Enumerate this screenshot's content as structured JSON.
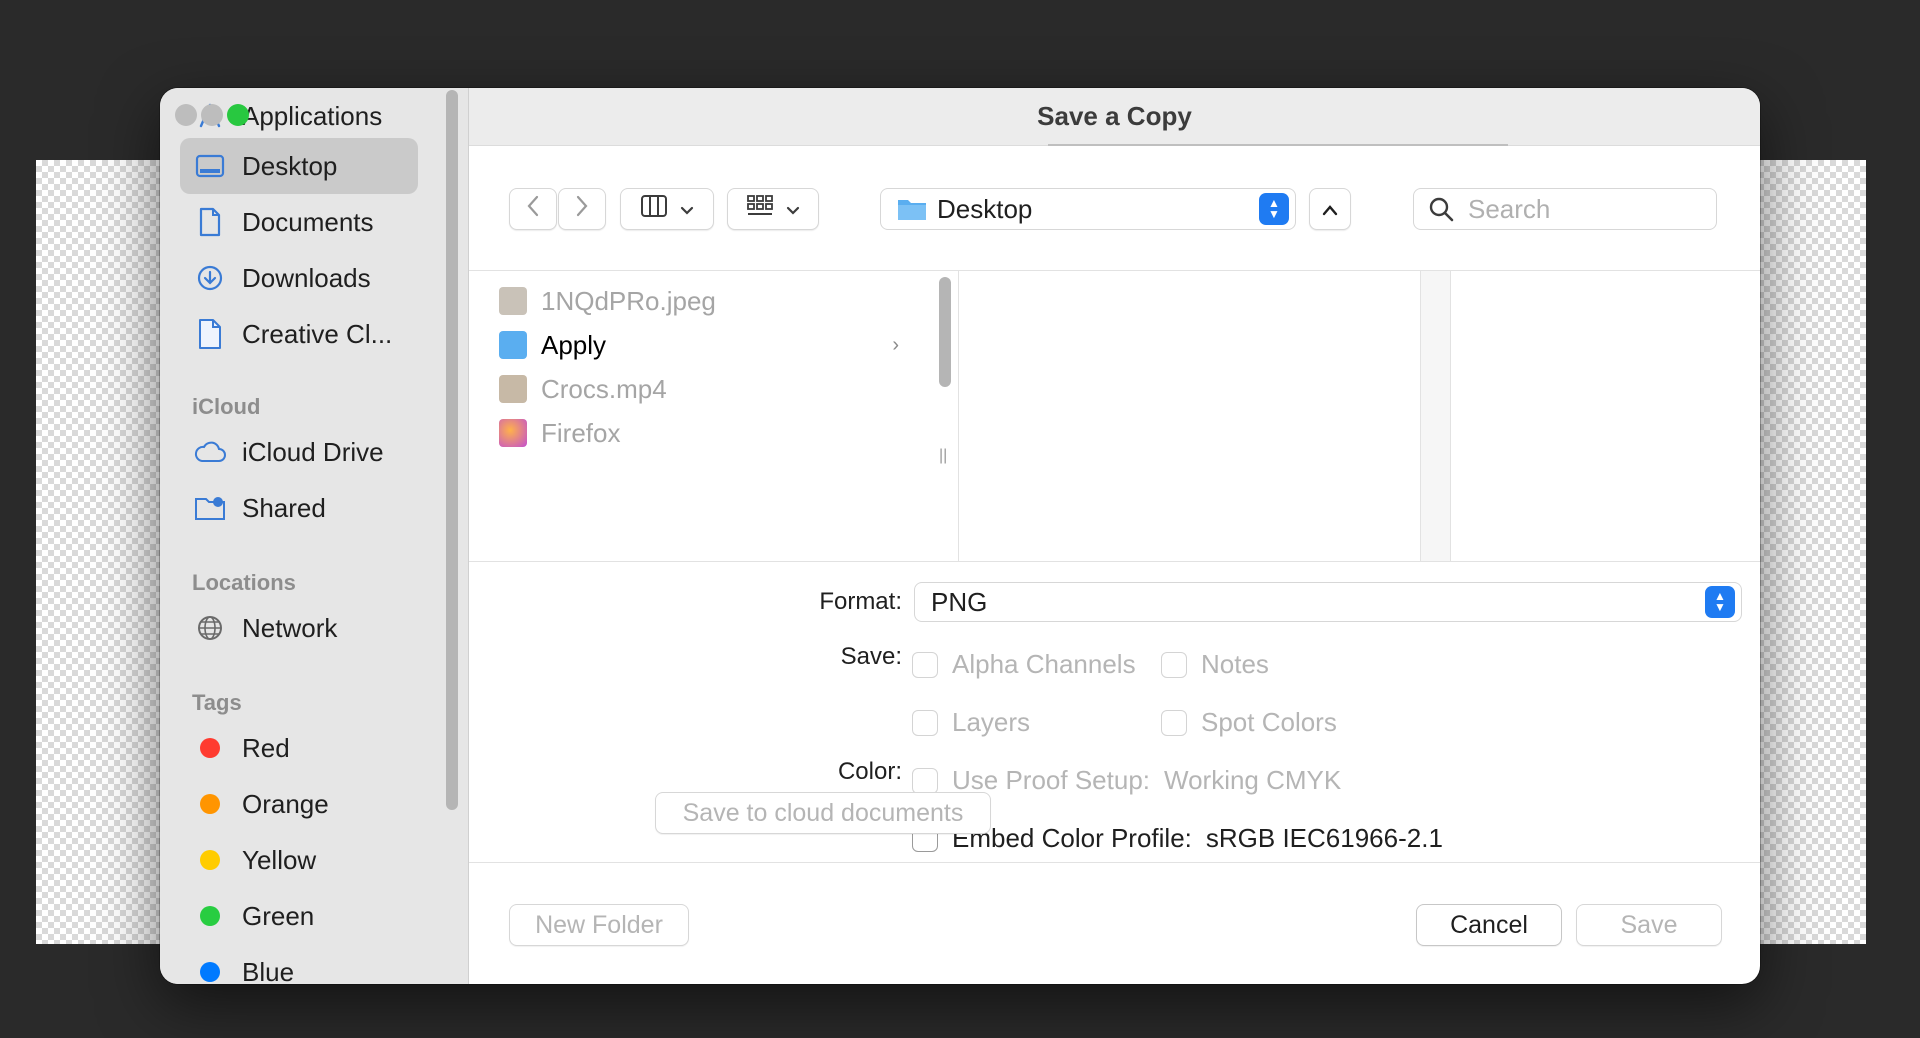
{
  "dialog": {
    "title": "Save a Copy"
  },
  "sidebar": {
    "favorites": [
      {
        "label": "Applications",
        "icon": "applications-icon"
      },
      {
        "label": "Desktop",
        "icon": "desktop-icon",
        "selected": true
      },
      {
        "label": "Documents",
        "icon": "document-icon"
      },
      {
        "label": "Downloads",
        "icon": "downloads-icon"
      },
      {
        "label": "Creative Cl...",
        "icon": "document-icon"
      }
    ],
    "icloud_header": "iCloud",
    "icloud": [
      {
        "label": "iCloud Drive",
        "icon": "cloud-icon"
      },
      {
        "label": "Shared",
        "icon": "shared-folder-icon"
      }
    ],
    "locations_header": "Locations",
    "locations": [
      {
        "label": "Network",
        "icon": "globe-icon"
      }
    ],
    "tags_header": "Tags",
    "tags": [
      {
        "label": "Red",
        "color": "#ff3b30"
      },
      {
        "label": "Orange",
        "color": "#ff9500"
      },
      {
        "label": "Yellow",
        "color": "#ffcc00"
      },
      {
        "label": "Green",
        "color": "#28cd41"
      },
      {
        "label": "Blue",
        "color": "#007aff"
      }
    ]
  },
  "toolbar": {
    "location": "Desktop",
    "search_placeholder": "Search"
  },
  "files": [
    {
      "name": "1NQdPRo.jpeg",
      "dim": true,
      "icon": "image-file-icon"
    },
    {
      "name": "Apply",
      "dim": false,
      "icon": "folder-icon",
      "folder": true
    },
    {
      "name": "Crocs.mp4",
      "dim": true,
      "icon": "video-file-icon"
    },
    {
      "name": "Firefox",
      "dim": true,
      "icon": "firefox-icon"
    }
  ],
  "options": {
    "format_label": "Format:",
    "format_value": "PNG",
    "save_label": "Save:",
    "alpha_channels": "Alpha Channels",
    "notes": "Notes",
    "layers": "Layers",
    "spot_colors": "Spot Colors",
    "color_label": "Color:",
    "use_proof_setup": "Use Proof Setup:",
    "proof_value": "Working CMYK",
    "embed_profile": "Embed Color Profile:",
    "profile_value": "sRGB IEC61966-2.1",
    "save_to_cloud": "Save to cloud documents"
  },
  "footer": {
    "new_folder": "New Folder",
    "cancel": "Cancel",
    "save": "Save"
  },
  "colors": {
    "accent": "#1f7bf2",
    "traffic_close": "#bdbdbd",
    "traffic_min": "#bdbdbd",
    "traffic_zoom": "#28c840"
  }
}
